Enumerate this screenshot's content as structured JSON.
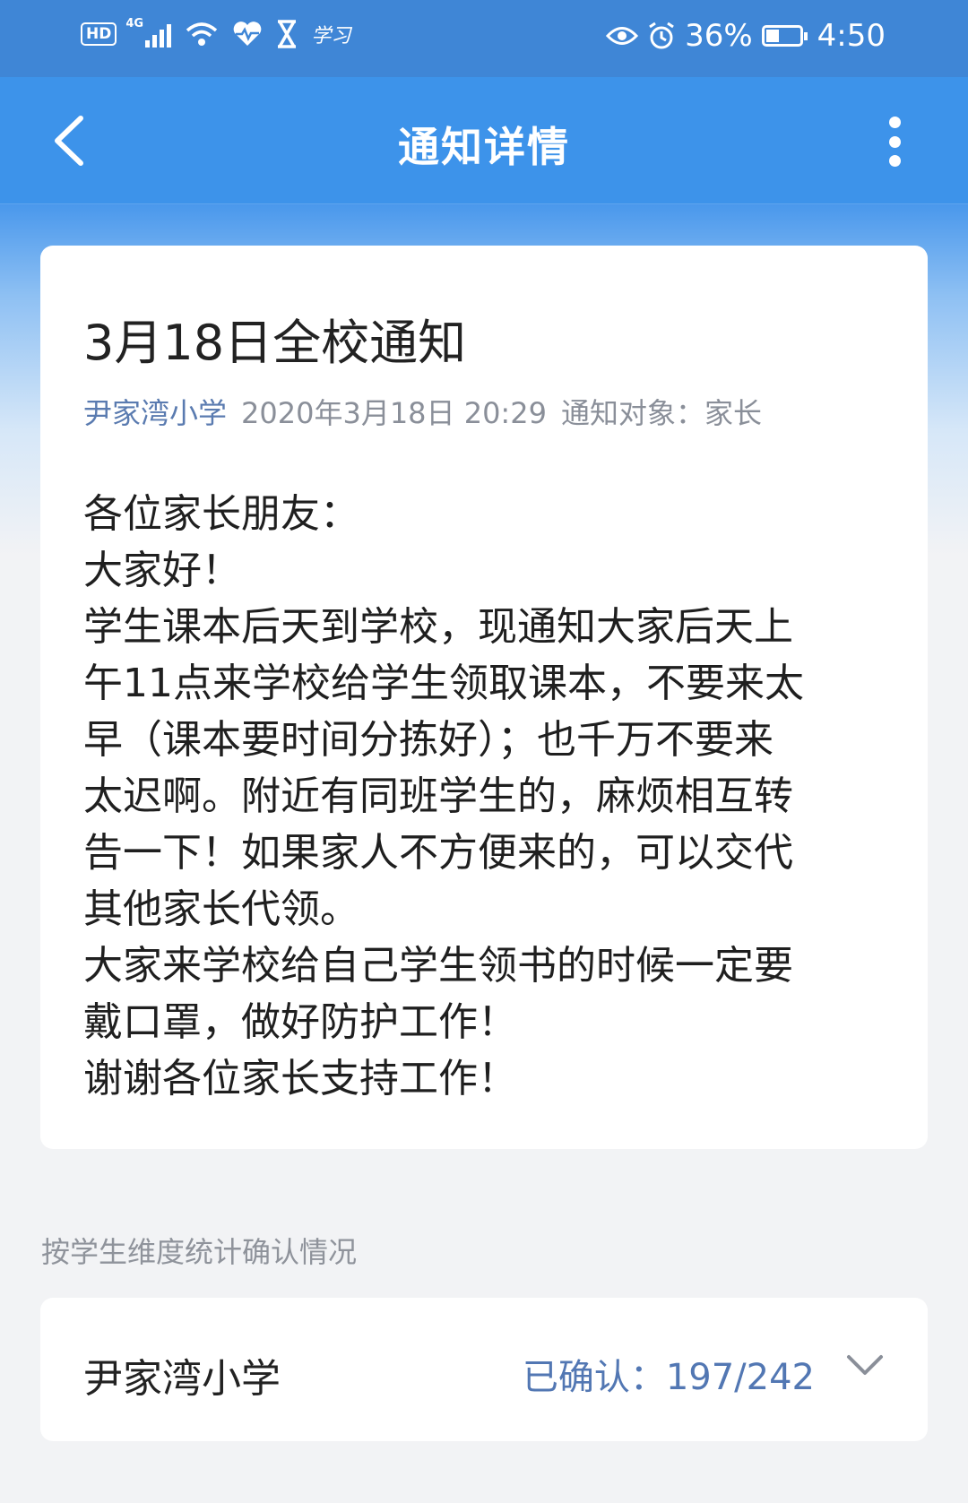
{
  "status_bar": {
    "hd": "HD",
    "network": "4G",
    "study_label": "学习",
    "battery": "36%",
    "time": "4:50"
  },
  "header": {
    "title": "通知详情"
  },
  "notice": {
    "title": "3月18日全校通知",
    "school": "尹家湾小学",
    "datetime": "2020年3月18日 20:29",
    "audience": "通知对象：家长",
    "lines": [
      "各位家长朋友：",
      "大家好！",
      "学生课本后天到学校，现通知大家后天上",
      "午11点来学校给学生领取课本，不要来太",
      "早（课本要时间分拣好）；也千万不要来",
      "太迟啊。附近有同班学生的，麻烦相互转",
      "告一下！如果家人不方便来的，可以交代",
      "其他家长代领。",
      "大家来学校给自己学生领书的时候一定要",
      "戴口罩，做好防护工作！",
      "谢谢各位家长支持工作！"
    ]
  },
  "stats": {
    "section_label": "按学生维度统计确认情况",
    "school": "尹家湾小学",
    "confirmed_label": "已确认：",
    "confirmed_count": "197/242"
  },
  "icons": {
    "back": "chevron-left-icon",
    "more": "more-vertical-icon",
    "expand": "chevron-down-icon",
    "eye": "eye-icon",
    "alarm": "alarm-icon",
    "wifi": "wifi-icon",
    "heart": "heart-rate-icon",
    "hourglass": "hourglass-icon"
  },
  "colors": {
    "header": "#3d93ea",
    "status_bar": "#3f86d6",
    "meta_school": "#5a7bb0",
    "confirm": "#5277b3"
  }
}
